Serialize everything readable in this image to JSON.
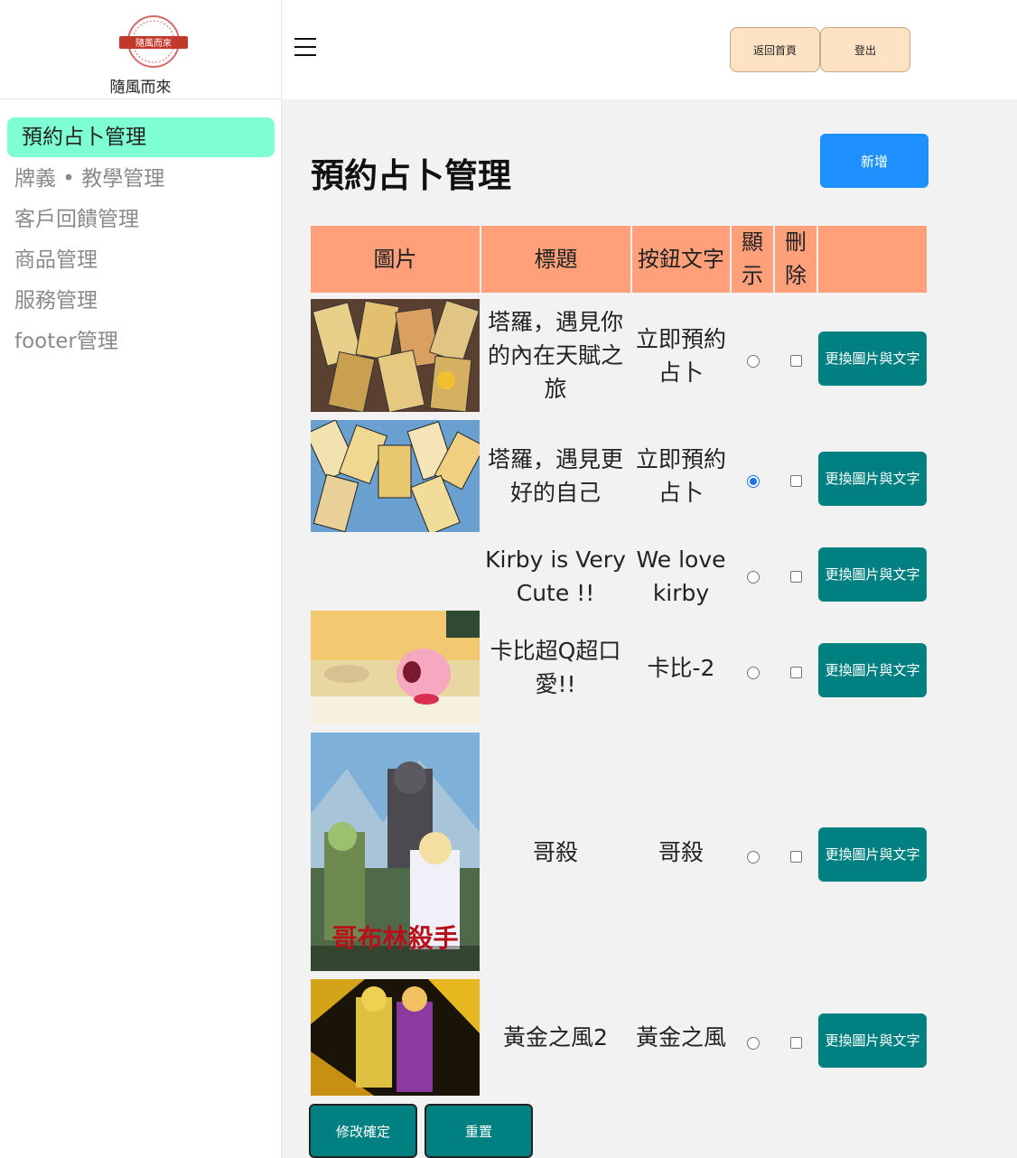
{
  "brand": {
    "logo_text": "隨風而來"
  },
  "header": {
    "home_button": "返回首頁",
    "logout_button": "登出"
  },
  "sidebar": {
    "items": [
      {
        "label": "預約占卜管理"
      },
      {
        "label": "牌義 • 教學管理"
      },
      {
        "label": "客戶回饋管理"
      },
      {
        "label": "商品管理"
      },
      {
        "label": "服務管理"
      },
      {
        "label": "footer管理"
      }
    ]
  },
  "main": {
    "title": "預約占卜管理",
    "add_button": "新增",
    "columns": {
      "image": "圖片",
      "title": "標題",
      "button_text": "按鈕文字",
      "show": "顯示",
      "delete": "刪除"
    },
    "change_button": "更換圖片與文字",
    "rows": [
      {
        "title": "塔羅，遇見你的內在天賦之旅",
        "button_text": "立即預約占卜",
        "show": false,
        "delete": false,
        "image": "tarot-cards-on-wood"
      },
      {
        "title": "塔羅，遇見更好的自己",
        "button_text": "立即預約占卜",
        "show": true,
        "delete": false,
        "image": "tarot-cards-scattered-blue"
      },
      {
        "title": "Kirby is Very Cute !!",
        "button_text": "We love kirby",
        "show": false,
        "delete": false,
        "image": ""
      },
      {
        "title": "卡比超Q超口愛!!",
        "button_text": "卡比-2",
        "show": false,
        "delete": false,
        "image": "kirby-anime-scene"
      },
      {
        "title": "哥殺",
        "button_text": "哥殺",
        "show": false,
        "delete": false,
        "image": "goblin-slayer-poster",
        "image_caption": "哥布林殺手"
      },
      {
        "title": "黃金之風2",
        "button_text": "黃金之風",
        "show": false,
        "delete": false,
        "image": "jojo-golden-wind-art"
      }
    ],
    "confirm_button": "修改確定",
    "reset_button": "重置"
  }
}
